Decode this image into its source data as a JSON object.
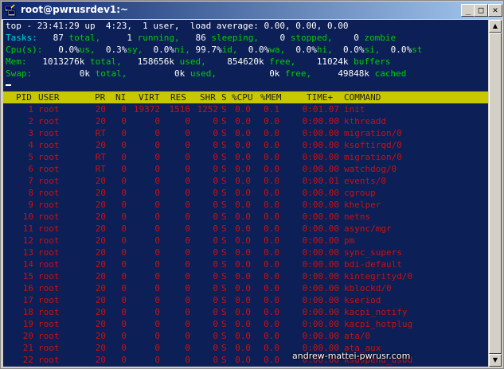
{
  "window": {
    "title": "root@pwrusrdev1:~"
  },
  "summary": {
    "top_line": "top - 23:41:29 up  4:23,  1 user,  load average: 0.00, 0.00, 0.00",
    "tasks": {
      "label": "Tasks:",
      "total": "87",
      "total_label": " total,",
      "running": "1",
      "running_label": " running,",
      "sleeping": "86",
      "sleeping_label": " sleeping,",
      "stopped": "0",
      "stopped_label": " stopped,",
      "zombie": "0",
      "zombie_label": " zombie"
    },
    "cpu": {
      "label": "Cpu(s):",
      "us": "0.0%",
      "us_label": "us,",
      "sy": "0.3%",
      "sy_label": "sy,",
      "ni": "0.0%",
      "ni_label": "ni,",
      "id": "99.7%",
      "id_label": "id,",
      "wa": "0.0%",
      "wa_label": "wa,",
      "hi": "0.0%",
      "hi_label": "hi,",
      "si": "0.0%",
      "si_label": "si,",
      "st": "0.0%",
      "st_label": "st"
    },
    "mem": {
      "label": "Mem:",
      "total": "1013276k",
      "total_label": " total,",
      "used": "158656k",
      "used_label": " used,",
      "free": "854620k",
      "free_label": " free,",
      "buffers": "11024k",
      "buffers_label": " buffers"
    },
    "swap": {
      "label": "Swap:",
      "total": "0k",
      "total_label": " total,",
      "used": "0k",
      "used_label": " used,",
      "free": "0k",
      "free_label": " free,",
      "cached": "49848k",
      "cached_label": " cached"
    }
  },
  "columns": [
    "PID",
    "USER",
    "PR",
    "NI",
    "VIRT",
    "RES",
    "SHR",
    "S",
    "%CPU",
    "%MEM",
    "TIME+",
    "COMMAND"
  ],
  "processes": [
    {
      "pid": "1",
      "user": "root",
      "pr": "20",
      "ni": "0",
      "virt": "19372",
      "res": "1516",
      "shr": "1252",
      "s": "S",
      "cpu": "0.0",
      "mem": "0.1",
      "time": "0:01.07",
      "cmd": "init"
    },
    {
      "pid": "2",
      "user": "root",
      "pr": "20",
      "ni": "0",
      "virt": "0",
      "res": "0",
      "shr": "0",
      "s": "S",
      "cpu": "0.0",
      "mem": "0.0",
      "time": "0:00.00",
      "cmd": "kthreadd"
    },
    {
      "pid": "3",
      "user": "root",
      "pr": "RT",
      "ni": "0",
      "virt": "0",
      "res": "0",
      "shr": "0",
      "s": "S",
      "cpu": "0.0",
      "mem": "0.0",
      "time": "0:00.00",
      "cmd": "migration/0"
    },
    {
      "pid": "4",
      "user": "root",
      "pr": "20",
      "ni": "0",
      "virt": "0",
      "res": "0",
      "shr": "0",
      "s": "S",
      "cpu": "0.0",
      "mem": "0.0",
      "time": "0:00.00",
      "cmd": "ksoftirqd/0"
    },
    {
      "pid": "5",
      "user": "root",
      "pr": "RT",
      "ni": "0",
      "virt": "0",
      "res": "0",
      "shr": "0",
      "s": "S",
      "cpu": "0.0",
      "mem": "0.0",
      "time": "0:00.00",
      "cmd": "migration/0"
    },
    {
      "pid": "6",
      "user": "root",
      "pr": "RT",
      "ni": "0",
      "virt": "0",
      "res": "0",
      "shr": "0",
      "s": "S",
      "cpu": "0.0",
      "mem": "0.0",
      "time": "0:00.00",
      "cmd": "watchdog/0"
    },
    {
      "pid": "7",
      "user": "root",
      "pr": "20",
      "ni": "0",
      "virt": "0",
      "res": "0",
      "shr": "0",
      "s": "S",
      "cpu": "0.0",
      "mem": "0.0",
      "time": "0:00.01",
      "cmd": "events/0"
    },
    {
      "pid": "8",
      "user": "root",
      "pr": "20",
      "ni": "0",
      "virt": "0",
      "res": "0",
      "shr": "0",
      "s": "S",
      "cpu": "0.0",
      "mem": "0.0",
      "time": "0:00.00",
      "cmd": "cgroup"
    },
    {
      "pid": "9",
      "user": "root",
      "pr": "20",
      "ni": "0",
      "virt": "0",
      "res": "0",
      "shr": "0",
      "s": "S",
      "cpu": "0.0",
      "mem": "0.0",
      "time": "0:00.00",
      "cmd": "khelper"
    },
    {
      "pid": "10",
      "user": "root",
      "pr": "20",
      "ni": "0",
      "virt": "0",
      "res": "0",
      "shr": "0",
      "s": "S",
      "cpu": "0.0",
      "mem": "0.0",
      "time": "0:00.00",
      "cmd": "netns"
    },
    {
      "pid": "11",
      "user": "root",
      "pr": "20",
      "ni": "0",
      "virt": "0",
      "res": "0",
      "shr": "0",
      "s": "S",
      "cpu": "0.0",
      "mem": "0.0",
      "time": "0:00.00",
      "cmd": "async/mgr"
    },
    {
      "pid": "12",
      "user": "root",
      "pr": "20",
      "ni": "0",
      "virt": "0",
      "res": "0",
      "shr": "0",
      "s": "S",
      "cpu": "0.0",
      "mem": "0.0",
      "time": "0:00.00",
      "cmd": "pm"
    },
    {
      "pid": "13",
      "user": "root",
      "pr": "20",
      "ni": "0",
      "virt": "0",
      "res": "0",
      "shr": "0",
      "s": "S",
      "cpu": "0.0",
      "mem": "0.0",
      "time": "0:00.00",
      "cmd": "sync_supers"
    },
    {
      "pid": "14",
      "user": "root",
      "pr": "20",
      "ni": "0",
      "virt": "0",
      "res": "0",
      "shr": "0",
      "s": "S",
      "cpu": "0.0",
      "mem": "0.0",
      "time": "0:00.00",
      "cmd": "bdi-default"
    },
    {
      "pid": "15",
      "user": "root",
      "pr": "20",
      "ni": "0",
      "virt": "0",
      "res": "0",
      "shr": "0",
      "s": "S",
      "cpu": "0.0",
      "mem": "0.0",
      "time": "0:00.00",
      "cmd": "kintegrityd/0"
    },
    {
      "pid": "16",
      "user": "root",
      "pr": "20",
      "ni": "0",
      "virt": "0",
      "res": "0",
      "shr": "0",
      "s": "S",
      "cpu": "0.0",
      "mem": "0.0",
      "time": "0:00.00",
      "cmd": "kblockd/0"
    },
    {
      "pid": "17",
      "user": "root",
      "pr": "20",
      "ni": "0",
      "virt": "0",
      "res": "0",
      "shr": "0",
      "s": "S",
      "cpu": "0.0",
      "mem": "0.0",
      "time": "0:00.00",
      "cmd": "kseriod"
    },
    {
      "pid": "18",
      "user": "root",
      "pr": "20",
      "ni": "0",
      "virt": "0",
      "res": "0",
      "shr": "0",
      "s": "S",
      "cpu": "0.0",
      "mem": "0.0",
      "time": "0:00.00",
      "cmd": "kacpi_notify"
    },
    {
      "pid": "19",
      "user": "root",
      "pr": "20",
      "ni": "0",
      "virt": "0",
      "res": "0",
      "shr": "0",
      "s": "S",
      "cpu": "0.0",
      "mem": "0.0",
      "time": "0:00.00",
      "cmd": "kacpi_hotplug"
    },
    {
      "pid": "20",
      "user": "root",
      "pr": "20",
      "ni": "0",
      "virt": "0",
      "res": "0",
      "shr": "0",
      "s": "S",
      "cpu": "0.0",
      "mem": "0.0",
      "time": "0:00.00",
      "cmd": "ata/0"
    },
    {
      "pid": "21",
      "user": "root",
      "pr": "20",
      "ni": "0",
      "virt": "0",
      "res": "0",
      "shr": "0",
      "s": "S",
      "cpu": "0.0",
      "mem": "0.0",
      "time": "0:00.00",
      "cmd": "ata_aux"
    },
    {
      "pid": "22",
      "user": "root",
      "pr": "20",
      "ni": "0",
      "virt": "0",
      "res": "0",
      "shr": "0",
      "s": "S",
      "cpu": "0.0",
      "mem": "0.0",
      "time": "0:00.00",
      "cmd": "ksuspend_usbd"
    }
  ],
  "watermark": "andrew-mattei-pwrusr.com",
  "colors": {
    "terminal_bg": "#0c1f56",
    "header_bg": "#c8c800",
    "row_text": "#cc1010",
    "values": "#ffffff",
    "labels": "#00d000",
    "summary": "#00d8d8"
  }
}
